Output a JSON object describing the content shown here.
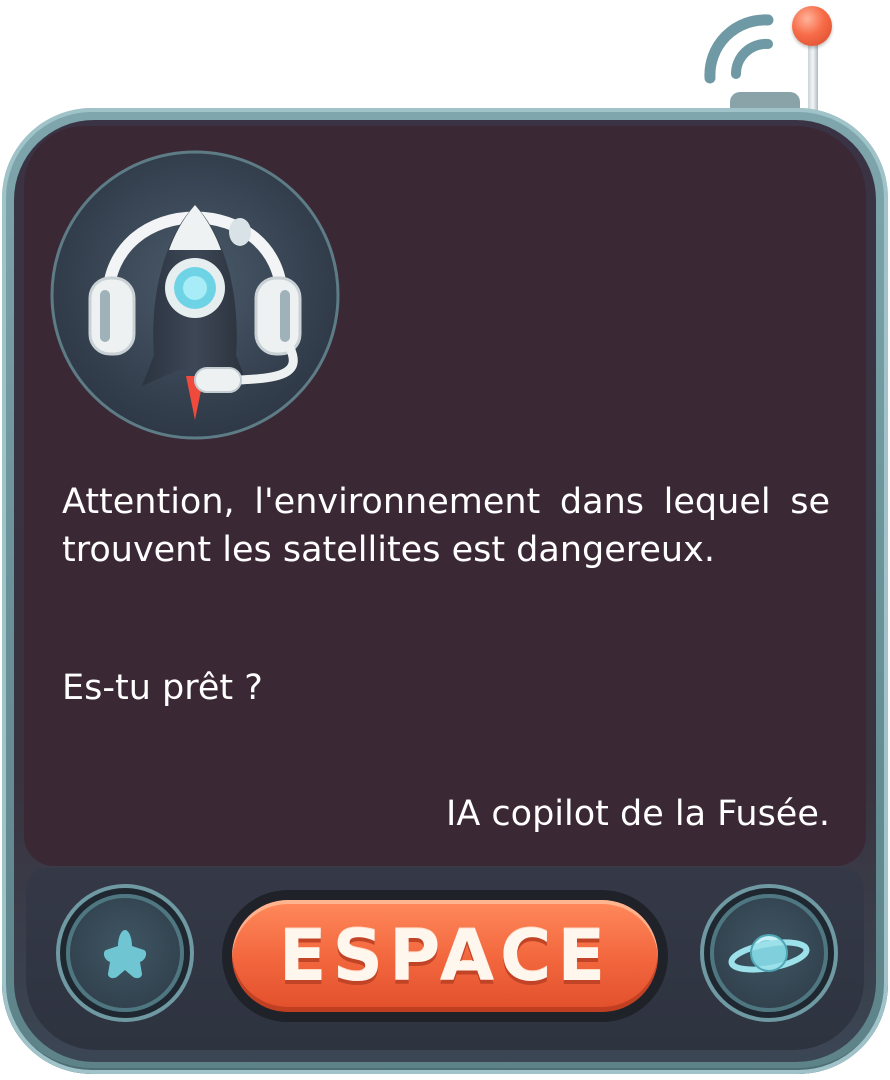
{
  "dialog": {
    "message": "Attention, l'environnement dans lequel se trouvent les satellites est dangereux.",
    "question": "Es-tu prêt ?",
    "signature": "IA copilot de la Fusée."
  },
  "controls": {
    "left_icon": "star-icon",
    "center_label": "ESPACE",
    "right_icon": "planet-icon"
  },
  "avatar": {
    "icon": "rocket-headset-icon"
  },
  "colors": {
    "screen": "#3b2835",
    "frame": "#6a9299",
    "accent": "#f3683f",
    "text": "#ffffff"
  }
}
